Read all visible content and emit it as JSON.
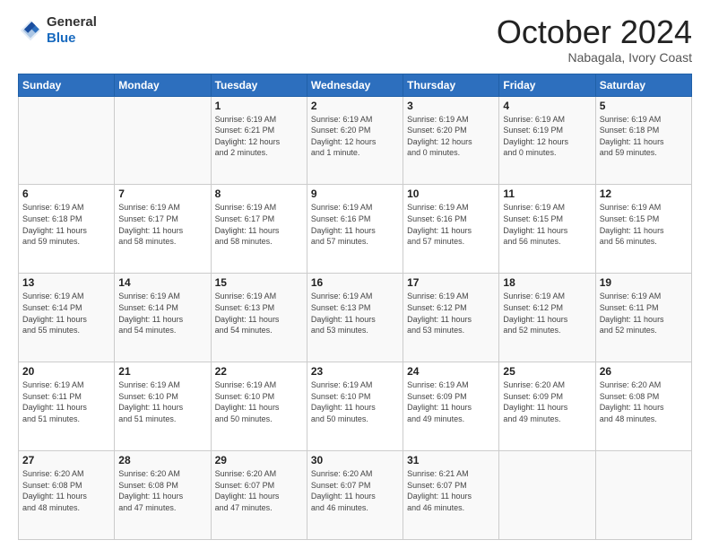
{
  "header": {
    "logo_general": "General",
    "logo_blue": "Blue",
    "month_title": "October 2024",
    "location": "Nabagala, Ivory Coast"
  },
  "days_of_week": [
    "Sunday",
    "Monday",
    "Tuesday",
    "Wednesday",
    "Thursday",
    "Friday",
    "Saturday"
  ],
  "weeks": [
    [
      {
        "day": "",
        "info": ""
      },
      {
        "day": "",
        "info": ""
      },
      {
        "day": "1",
        "info": "Sunrise: 6:19 AM\nSunset: 6:21 PM\nDaylight: 12 hours\nand 2 minutes."
      },
      {
        "day": "2",
        "info": "Sunrise: 6:19 AM\nSunset: 6:20 PM\nDaylight: 12 hours\nand 1 minute."
      },
      {
        "day": "3",
        "info": "Sunrise: 6:19 AM\nSunset: 6:20 PM\nDaylight: 12 hours\nand 0 minutes."
      },
      {
        "day": "4",
        "info": "Sunrise: 6:19 AM\nSunset: 6:19 PM\nDaylight: 12 hours\nand 0 minutes."
      },
      {
        "day": "5",
        "info": "Sunrise: 6:19 AM\nSunset: 6:18 PM\nDaylight: 11 hours\nand 59 minutes."
      }
    ],
    [
      {
        "day": "6",
        "info": "Sunrise: 6:19 AM\nSunset: 6:18 PM\nDaylight: 11 hours\nand 59 minutes."
      },
      {
        "day": "7",
        "info": "Sunrise: 6:19 AM\nSunset: 6:17 PM\nDaylight: 11 hours\nand 58 minutes."
      },
      {
        "day": "8",
        "info": "Sunrise: 6:19 AM\nSunset: 6:17 PM\nDaylight: 11 hours\nand 58 minutes."
      },
      {
        "day": "9",
        "info": "Sunrise: 6:19 AM\nSunset: 6:16 PM\nDaylight: 11 hours\nand 57 minutes."
      },
      {
        "day": "10",
        "info": "Sunrise: 6:19 AM\nSunset: 6:16 PM\nDaylight: 11 hours\nand 57 minutes."
      },
      {
        "day": "11",
        "info": "Sunrise: 6:19 AM\nSunset: 6:15 PM\nDaylight: 11 hours\nand 56 minutes."
      },
      {
        "day": "12",
        "info": "Sunrise: 6:19 AM\nSunset: 6:15 PM\nDaylight: 11 hours\nand 56 minutes."
      }
    ],
    [
      {
        "day": "13",
        "info": "Sunrise: 6:19 AM\nSunset: 6:14 PM\nDaylight: 11 hours\nand 55 minutes."
      },
      {
        "day": "14",
        "info": "Sunrise: 6:19 AM\nSunset: 6:14 PM\nDaylight: 11 hours\nand 54 minutes."
      },
      {
        "day": "15",
        "info": "Sunrise: 6:19 AM\nSunset: 6:13 PM\nDaylight: 11 hours\nand 54 minutes."
      },
      {
        "day": "16",
        "info": "Sunrise: 6:19 AM\nSunset: 6:13 PM\nDaylight: 11 hours\nand 53 minutes."
      },
      {
        "day": "17",
        "info": "Sunrise: 6:19 AM\nSunset: 6:12 PM\nDaylight: 11 hours\nand 53 minutes."
      },
      {
        "day": "18",
        "info": "Sunrise: 6:19 AM\nSunset: 6:12 PM\nDaylight: 11 hours\nand 52 minutes."
      },
      {
        "day": "19",
        "info": "Sunrise: 6:19 AM\nSunset: 6:11 PM\nDaylight: 11 hours\nand 52 minutes."
      }
    ],
    [
      {
        "day": "20",
        "info": "Sunrise: 6:19 AM\nSunset: 6:11 PM\nDaylight: 11 hours\nand 51 minutes."
      },
      {
        "day": "21",
        "info": "Sunrise: 6:19 AM\nSunset: 6:10 PM\nDaylight: 11 hours\nand 51 minutes."
      },
      {
        "day": "22",
        "info": "Sunrise: 6:19 AM\nSunset: 6:10 PM\nDaylight: 11 hours\nand 50 minutes."
      },
      {
        "day": "23",
        "info": "Sunrise: 6:19 AM\nSunset: 6:10 PM\nDaylight: 11 hours\nand 50 minutes."
      },
      {
        "day": "24",
        "info": "Sunrise: 6:19 AM\nSunset: 6:09 PM\nDaylight: 11 hours\nand 49 minutes."
      },
      {
        "day": "25",
        "info": "Sunrise: 6:20 AM\nSunset: 6:09 PM\nDaylight: 11 hours\nand 49 minutes."
      },
      {
        "day": "26",
        "info": "Sunrise: 6:20 AM\nSunset: 6:08 PM\nDaylight: 11 hours\nand 48 minutes."
      }
    ],
    [
      {
        "day": "27",
        "info": "Sunrise: 6:20 AM\nSunset: 6:08 PM\nDaylight: 11 hours\nand 48 minutes."
      },
      {
        "day": "28",
        "info": "Sunrise: 6:20 AM\nSunset: 6:08 PM\nDaylight: 11 hours\nand 47 minutes."
      },
      {
        "day": "29",
        "info": "Sunrise: 6:20 AM\nSunset: 6:07 PM\nDaylight: 11 hours\nand 47 minutes."
      },
      {
        "day": "30",
        "info": "Sunrise: 6:20 AM\nSunset: 6:07 PM\nDaylight: 11 hours\nand 46 minutes."
      },
      {
        "day": "31",
        "info": "Sunrise: 6:21 AM\nSunset: 6:07 PM\nDaylight: 11 hours\nand 46 minutes."
      },
      {
        "day": "",
        "info": ""
      },
      {
        "day": "",
        "info": ""
      }
    ]
  ]
}
